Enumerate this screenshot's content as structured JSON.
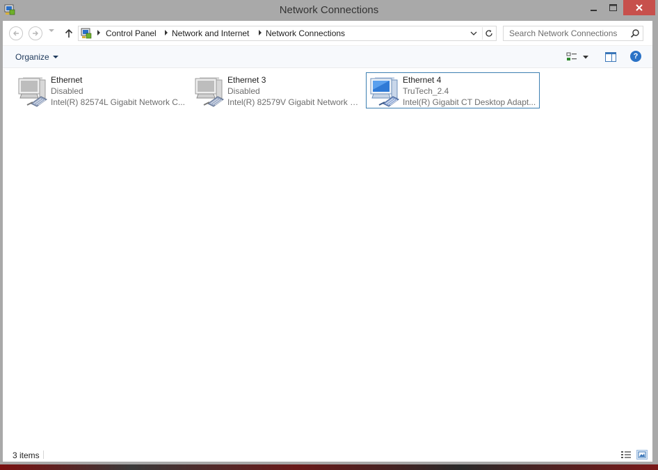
{
  "window": {
    "title": "Network Connections",
    "accent_close": "#c7504c"
  },
  "navigation": {
    "back_icon": "back-arrow-icon",
    "forward_icon": "forward-arrow-icon",
    "up_icon": "up-arrow-icon",
    "breadcrumbs": [
      "Control Panel",
      "Network and Internet",
      "Network Connections"
    ]
  },
  "search": {
    "placeholder": "Search Network Connections"
  },
  "commandbar": {
    "organize_label": "Organize"
  },
  "connections": [
    {
      "name": "Ethernet",
      "status": "Disabled",
      "device": "Intel(R) 82574L Gigabit Network C...",
      "state": "disabled",
      "selected": false
    },
    {
      "name": "Ethernet 3",
      "status": "Disabled",
      "device": "Intel(R) 82579V Gigabit Network C...",
      "state": "disabled",
      "selected": false
    },
    {
      "name": "Ethernet 4",
      "status": "TruTech_2.4",
      "device": "Intel(R) Gigabit CT Desktop Adapt...",
      "state": "connected",
      "selected": true
    }
  ],
  "statusbar": {
    "item_count": "3 items"
  }
}
